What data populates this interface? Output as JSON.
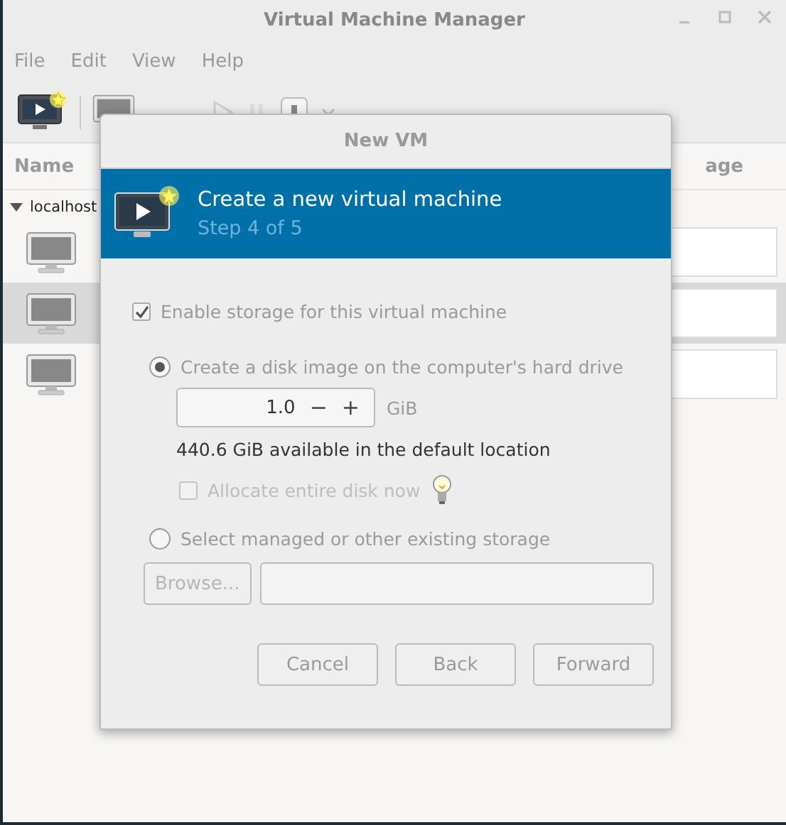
{
  "window": {
    "title": "Virtual Machine Manager"
  },
  "menu": [
    "File",
    "Edit",
    "View",
    "Help"
  ],
  "columns": [
    "Name",
    "age"
  ],
  "tree": {
    "label": "localhost",
    "expanded": true,
    "children": [
      {
        "selected": false
      },
      {
        "selected": true
      },
      {
        "selected": false
      }
    ]
  },
  "dialog": {
    "title": "New VM",
    "banner": {
      "title": "Create a new virtual machine",
      "subtitle": "Step 4 of 5"
    },
    "enable_storage": {
      "label": "Enable storage for this virtual machine",
      "checked": true,
      "disabled": true
    },
    "options": [
      {
        "label": "Create a disk image on the computer's hard drive",
        "selected": true,
        "disabled": true
      },
      {
        "label": "Select managed or other existing storage",
        "selected": false,
        "disabled": true
      }
    ],
    "size": {
      "value": "1.0",
      "decrement": "−",
      "increment": "+",
      "unit": "GiB"
    },
    "available": "440.6 GiB available in the default location",
    "allocate": {
      "label": "Allocate entire disk now",
      "checked": false,
      "disabled": true
    },
    "browse": {
      "label": "Browse...",
      "disabled": true
    },
    "buttons": [
      {
        "label": "Cancel",
        "disabled": true
      },
      {
        "label": "Back",
        "disabled": true
      },
      {
        "label": "Forward",
        "disabled": true
      }
    ]
  }
}
